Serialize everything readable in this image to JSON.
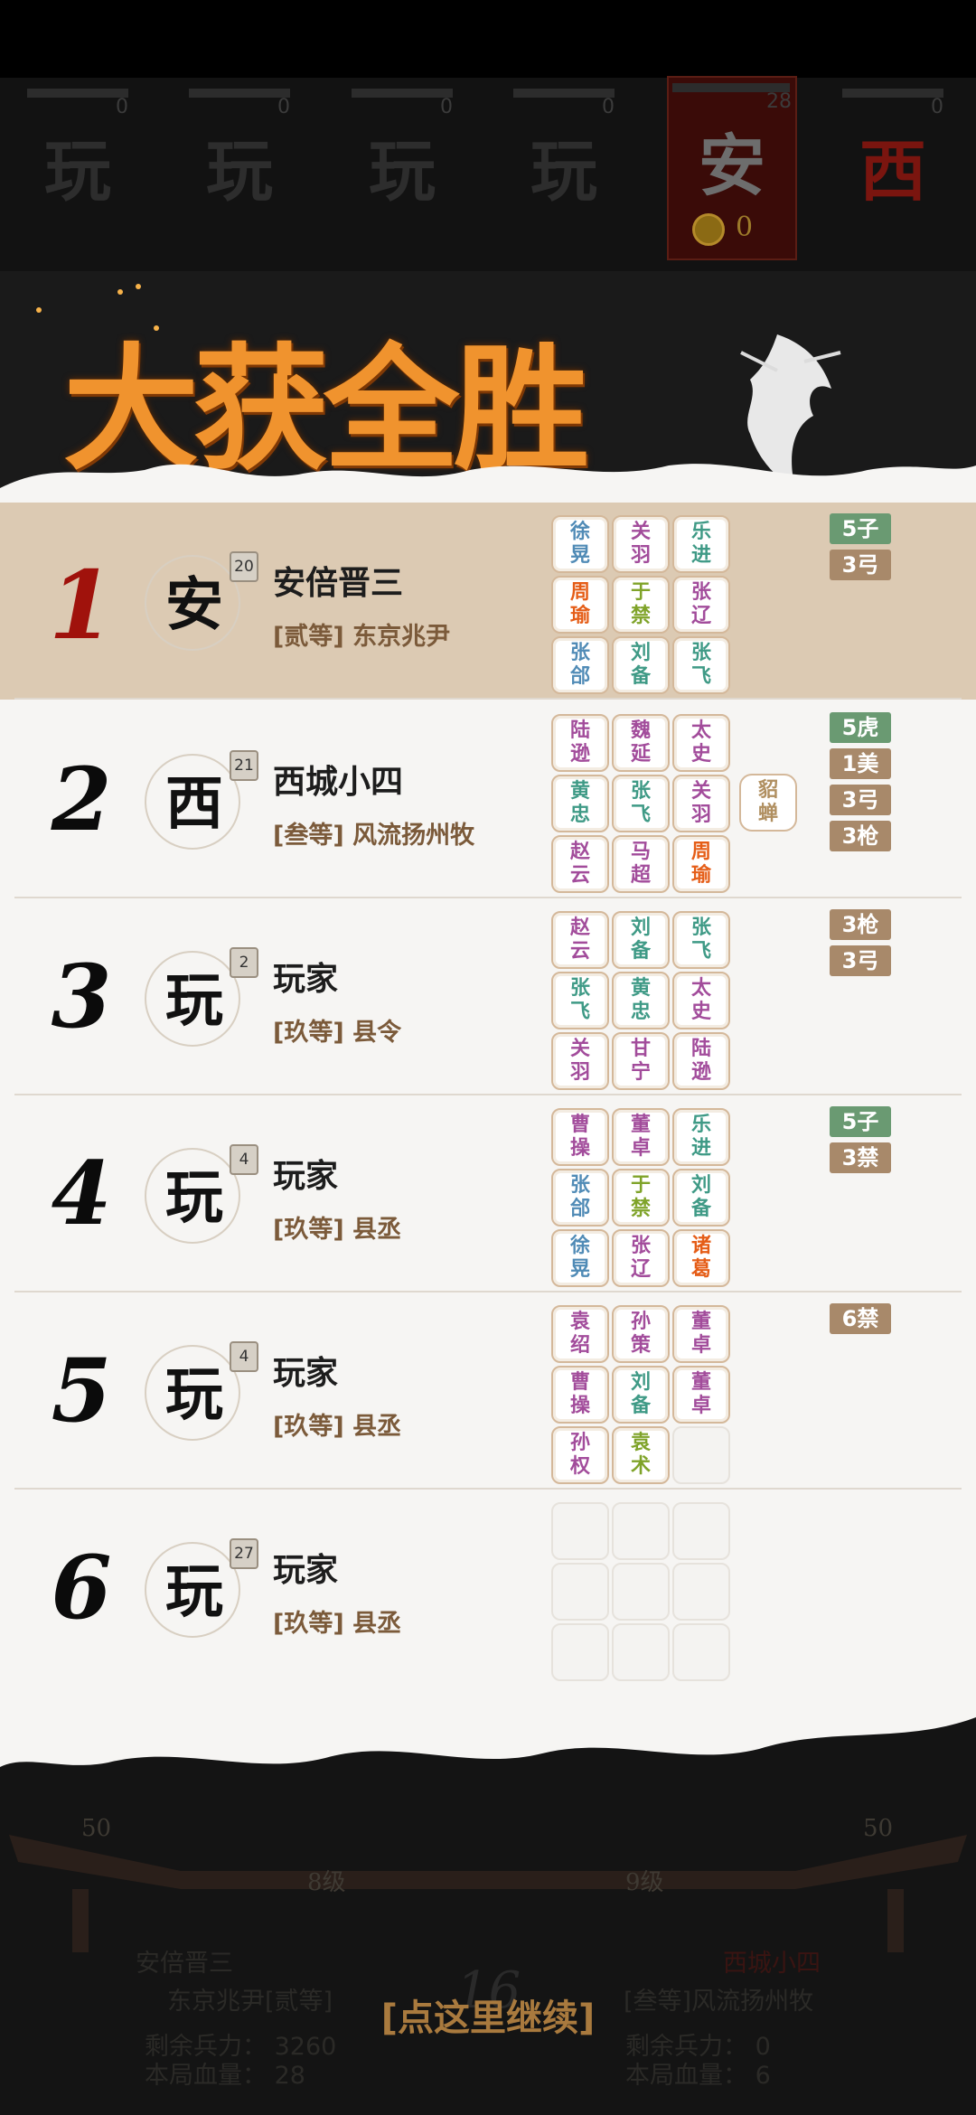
{
  "top_players": [
    {
      "glyph": "玩",
      "count": "0"
    },
    {
      "glyph": "玩",
      "count": "0"
    },
    {
      "glyph": "玩",
      "count": "0"
    },
    {
      "glyph": "玩",
      "count": "0"
    },
    {
      "glyph": "安",
      "count": "28",
      "coin": "0"
    },
    {
      "glyph": "西",
      "count": "0"
    }
  ],
  "banner": {
    "title": "大获全胜"
  },
  "rows": [
    {
      "rank": "1",
      "avatar": "安",
      "level": "20",
      "name": "安倍晋三",
      "title": "[贰等] 东京兆尹",
      "cards": [
        [
          "徐晃",
          "b"
        ],
        [
          "关羽",
          "p"
        ],
        [
          "乐进",
          "g"
        ],
        [
          "周瑜",
          "o"
        ],
        [
          "于禁",
          "y"
        ],
        [
          "张辽",
          "p"
        ],
        [
          "张郃",
          "b"
        ],
        [
          "刘备",
          "g"
        ],
        [
          "张飞",
          "g"
        ]
      ],
      "tags": [
        [
          "5子",
          "#6a9a72"
        ],
        [
          "3弓",
          "#a8896a"
        ]
      ]
    },
    {
      "rank": "2",
      "avatar": "西",
      "level": "21",
      "name": "西城小四",
      "title": "[叁等] 风流扬州牧",
      "cards": [
        [
          "陆逊",
          "p"
        ],
        [
          "魏延",
          "p"
        ],
        [
          "太史",
          "p"
        ],
        [
          "黄忠",
          "g"
        ],
        [
          "张飞",
          "g"
        ],
        [
          "关羽",
          "p"
        ],
        [
          "赵云",
          "p"
        ],
        [
          "马超",
          "p"
        ],
        [
          "周瑜",
          "o"
        ]
      ],
      "extra": "貂蝉",
      "tags": [
        [
          "5虎",
          "#6a9a72"
        ],
        [
          "1美",
          "#a8896a"
        ],
        [
          "3弓",
          "#a8896a"
        ],
        [
          "3枪",
          "#a8896a"
        ]
      ]
    },
    {
      "rank": "3",
      "avatar": "玩",
      "level": "2",
      "name": "玩家",
      "title": "[玖等] 县令",
      "cards": [
        [
          "赵云",
          "p"
        ],
        [
          "刘备",
          "g"
        ],
        [
          "张飞",
          "g"
        ],
        [
          "张飞",
          "g"
        ],
        [
          "黄忠",
          "g"
        ],
        [
          "太史",
          "p"
        ],
        [
          "关羽",
          "p"
        ],
        [
          "甘宁",
          "p"
        ],
        [
          "陆逊",
          "p"
        ]
      ],
      "tags": [
        [
          "3枪",
          "#a8896a"
        ],
        [
          "3弓",
          "#a8896a"
        ]
      ]
    },
    {
      "rank": "4",
      "avatar": "玩",
      "level": "4",
      "name": "玩家",
      "title": "[玖等] 县丞",
      "cards": [
        [
          "曹操",
          "p"
        ],
        [
          "董卓",
          "p"
        ],
        [
          "乐进",
          "g"
        ],
        [
          "张郃",
          "b"
        ],
        [
          "于禁",
          "y"
        ],
        [
          "刘备",
          "g"
        ],
        [
          "徐晃",
          "b"
        ],
        [
          "张辽",
          "p"
        ],
        [
          "诸葛",
          "o"
        ]
      ],
      "tags": [
        [
          "5子",
          "#6a9a72"
        ],
        [
          "3禁",
          "#a8896a"
        ]
      ]
    },
    {
      "rank": "5",
      "avatar": "玩",
      "level": "4",
      "name": "玩家",
      "title": "[玖等] 县丞",
      "cards": [
        [
          "袁绍",
          "p"
        ],
        [
          "孙策",
          "p"
        ],
        [
          "董卓",
          "p"
        ],
        [
          "曹操",
          "p"
        ],
        [
          "刘备",
          "g"
        ],
        [
          "董卓",
          "p"
        ],
        [
          "孙权",
          "p"
        ],
        [
          "袁术",
          "y"
        ],
        [
          "",
          ""
        ]
      ],
      "tags": [
        [
          "6禁",
          "#a8896a"
        ]
      ]
    },
    {
      "rank": "6",
      "avatar": "玩",
      "level": "27",
      "name": "玩家",
      "title": "[玖等] 县丞",
      "cards": [
        [
          "",
          ""
        ],
        [
          "",
          ""
        ],
        [
          "",
          ""
        ],
        [
          "",
          ""
        ],
        [
          "",
          ""
        ],
        [
          "",
          ""
        ],
        [
          "",
          ""
        ],
        [
          "",
          ""
        ],
        [
          "",
          ""
        ]
      ],
      "tags": []
    }
  ],
  "bottom": {
    "left_level_num": "50",
    "right_level_num": "50",
    "left_level": "8级",
    "right_level": "9级",
    "left_name": "安倍晋三",
    "left_rank": "东京兆尹[贰等]",
    "right_name": "西城小四",
    "right_rank": "[叁等]风流扬州牧",
    "left_troops": "剩余兵力： 3260",
    "left_hp": "本局血量： 28",
    "right_troops": "剩余兵力： 0",
    "right_hp": "本局血量： 6",
    "round": "16",
    "continue": "[点这里继续]"
  }
}
